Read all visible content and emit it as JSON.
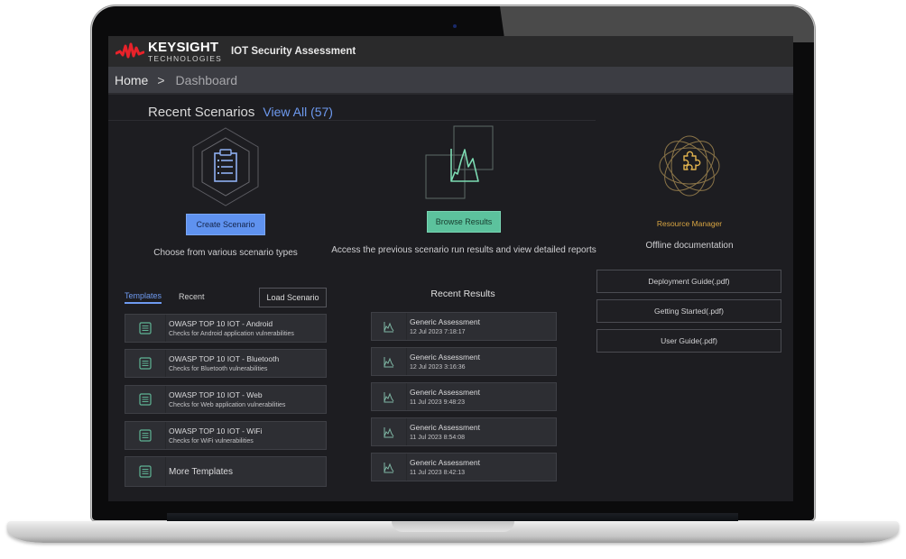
{
  "app": {
    "brand_name": "KEYSIGHT",
    "brand_sub": "TECHNOLOGIES",
    "title": "IOT Security Assessment",
    "brand_color": "#e8222a"
  },
  "breadcrumb": {
    "home": "Home",
    "separator": ">",
    "current": "Dashboard"
  },
  "recent_scenarios": {
    "title": "Recent Scenarios",
    "view_all": "View All (57)"
  },
  "features": {
    "create": {
      "icon": "clipboard-list-icon",
      "button": "Create Scenario",
      "description": "Choose from various scenario types",
      "accent": "#5f92ef"
    },
    "browse": {
      "icon": "chart-peaks-icon",
      "button": "Browse Results",
      "description": "Access the previous scenario run results and view detailed reports",
      "accent": "#5cc29d"
    },
    "resources": {
      "icon": "puzzle-orbit-icon",
      "link": "Resource Manager",
      "description": "Offline documentation",
      "accent": "#d7a442"
    }
  },
  "tabs": [
    {
      "label": "Templates",
      "active": true
    },
    {
      "label": "Recent",
      "active": false
    }
  ],
  "load_scenario": "Load Scenario",
  "templates": [
    {
      "title": "OWASP TOP 10 IOT - Android",
      "subtitle": "Checks for Android application vulnerabilities"
    },
    {
      "title": "OWASP TOP 10 IOT - Bluetooth",
      "subtitle": "Checks for Bluetooth vulnerabilities"
    },
    {
      "title": "OWASP TOP 10 IOT - Web",
      "subtitle": "Checks for Web application vulnerabilities"
    },
    {
      "title": "OWASP TOP 10 IOT - WiFi",
      "subtitle": "Checks for WiFi vulnerabilities"
    }
  ],
  "more_templates": "More Templates",
  "recent_results": {
    "title": "Recent Results",
    "items": [
      {
        "name": "Generic Assessment",
        "time": "12 Jul 2023 7:18:17"
      },
      {
        "name": "Generic Assessment",
        "time": "12 Jul 2023 3:16:36"
      },
      {
        "name": "Generic Assessment",
        "time": "11 Jul 2023 9:48:23"
      },
      {
        "name": "Generic Assessment",
        "time": "11 Jul 2023 8:54:08"
      },
      {
        "name": "Generic Assessment",
        "time": "11 Jul 2023 8:42:13"
      }
    ]
  },
  "docs": [
    {
      "label": "Deployment Guide(.pdf)"
    },
    {
      "label": "Getting Started(.pdf)"
    },
    {
      "label": "User Guide(.pdf)"
    }
  ]
}
